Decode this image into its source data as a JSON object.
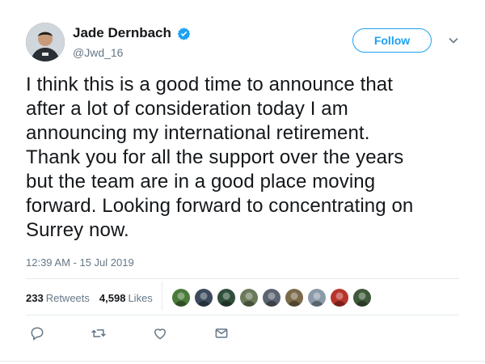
{
  "author": {
    "display_name": "Jade Dernbach",
    "handle": "@Jwd_16",
    "verified": true,
    "avatar_icon": "profile-photo"
  },
  "follow_label": "Follow",
  "tweet": {
    "lines": [
      "I think this is a good time to announce that",
      "after a lot of consideration today I am",
      "announcing my international retirement.",
      "Thank you for all the support over the years",
      "but the team are in a good place moving",
      "forward. Looking forward to concentrating on",
      "Surrey now."
    ],
    "timestamp": "12:39 AM - 15 Jul 2019"
  },
  "stats": {
    "retweets_count": "233",
    "retweets_label": "Retweets",
    "likes_count": "4,598",
    "likes_label": "Likes"
  },
  "liker_avatar_colors": [
    "#4a7a3a",
    "#3b4a5c",
    "#2f4f3a",
    "#6a7a5a",
    "#5c6470",
    "#7a6a4a",
    "#8a9aa8",
    "#b8342a",
    "#3f5a3a"
  ],
  "colors": {
    "accent": "#1da1f2",
    "text": "#14171a",
    "muted": "#657786",
    "border": "#e6ecf0"
  },
  "actions": [
    "reply-icon",
    "retweet-icon",
    "like-icon",
    "direct-message-icon"
  ]
}
